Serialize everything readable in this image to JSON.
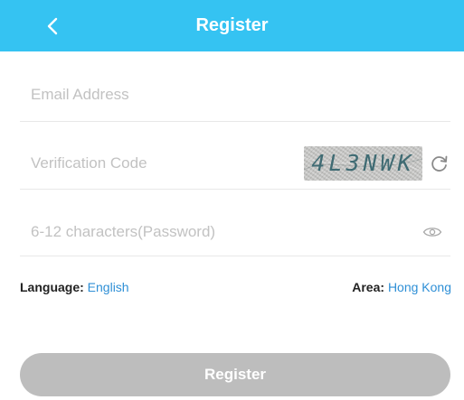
{
  "header": {
    "title": "Register",
    "background_color": "#35c3f2",
    "back_icon": "chevron-left-icon"
  },
  "form": {
    "email": {
      "placeholder": "Email Address",
      "value": ""
    },
    "verification": {
      "placeholder": "Verification Code",
      "value": "",
      "captcha_text": "4L3NWK",
      "refresh_icon": "refresh-icon"
    },
    "password": {
      "placeholder": "6-12 characters(Password)",
      "value": "",
      "visibility_icon": "eye-icon"
    }
  },
  "settings": {
    "language_label": "Language:",
    "language_value": "English",
    "area_label": "Area:",
    "area_value": "Hong Kong",
    "link_color": "#2e8fd6"
  },
  "actions": {
    "register_label": "Register",
    "register_color": "#bdbdbd"
  }
}
